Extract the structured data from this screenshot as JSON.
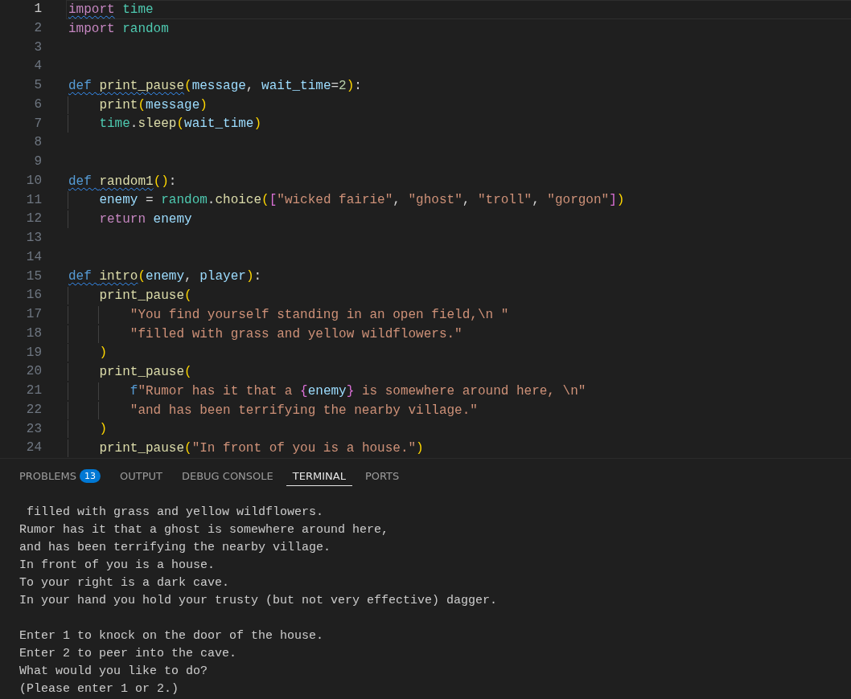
{
  "editor": {
    "lines": [
      {
        "number": "1",
        "selected": true,
        "tokens": [
          {
            "kind": "keyword",
            "text": "import",
            "warning": true
          },
          {
            "kind": "module",
            "text": " time",
            "warning": false
          }
        ]
      },
      {
        "number": "2",
        "selected": false,
        "tokens": [
          {
            "kind": "keyword",
            "text": "import",
            "warning": false
          },
          {
            "kind": "module",
            "text": " random",
            "warning": false
          }
        ]
      },
      {
        "number": "3",
        "selected": false
      },
      {
        "number": "4",
        "selected": false
      },
      {
        "number": "5",
        "selected": false,
        "tokens": [
          {
            "kind": "storage",
            "text": "def ",
            "warning": true
          },
          {
            "kind": "function",
            "text": "print_pause",
            "warning": true
          },
          {
            "kind": "bracket1",
            "text": "(",
            "warning": false
          },
          {
            "kind": "param",
            "text": "message",
            "warning": false
          },
          {
            "kind": "plain",
            "text": ",",
            "warning": false
          },
          {
            "kind": "param",
            "text": " wait_time",
            "warning": false
          },
          {
            "kind": "plain",
            "text": "=",
            "warning": false
          },
          {
            "kind": "number",
            "text": "2",
            "warning": false
          },
          {
            "kind": "bracket1",
            "text": ")",
            "warning": false
          },
          {
            "kind": "plain",
            "text": ":",
            "warning": false
          }
        ]
      },
      {
        "number": "6",
        "selected": false,
        "tokens": [
          {
            "kind": "function",
            "text": "    print",
            "warning": false
          },
          {
            "kind": "bracket1",
            "text": "(",
            "warning": false
          },
          {
            "kind": "param",
            "text": "message",
            "warning": false
          },
          {
            "kind": "bracket1",
            "text": ")",
            "warning": false
          }
        ]
      },
      {
        "number": "7",
        "selected": false,
        "tokens": [
          {
            "kind": "module",
            "text": "    time",
            "warning": false
          },
          {
            "kind": "plain",
            "text": ".",
            "warning": false
          },
          {
            "kind": "function",
            "text": "sleep",
            "warning": false
          },
          {
            "kind": "bracket1",
            "text": "(",
            "warning": false
          },
          {
            "kind": "param",
            "text": "wait_time",
            "warning": false
          },
          {
            "kind": "bracket1",
            "text": ")",
            "warning": false
          }
        ]
      },
      {
        "number": "8",
        "selected": false
      },
      {
        "number": "9",
        "selected": false
      },
      {
        "number": "10",
        "selected": false,
        "tokens": [
          {
            "kind": "storage",
            "text": "def ",
            "warning": true
          },
          {
            "kind": "function",
            "text": "random1",
            "warning": true
          },
          {
            "kind": "bracket1",
            "text": "()",
            "warning": false
          },
          {
            "kind": "plain",
            "text": ":",
            "warning": false
          }
        ]
      },
      {
        "number": "11",
        "selected": false,
        "tokens": [
          {
            "kind": "param",
            "text": "    enemy",
            "warning": false
          },
          {
            "kind": "plain",
            "text": " = ",
            "warning": false
          },
          {
            "kind": "module",
            "text": "random",
            "warning": false
          },
          {
            "kind": "plain",
            "text": ".",
            "warning": false
          },
          {
            "kind": "function",
            "text": "choice",
            "warning": false
          },
          {
            "kind": "bracket1",
            "text": "(",
            "warning": false
          },
          {
            "kind": "bracket2",
            "text": "[",
            "warning": false
          },
          {
            "kind": "string",
            "text": "\"wicked fairie\"",
            "warning": false
          },
          {
            "kind": "plain",
            "text": ", ",
            "warning": false
          },
          {
            "kind": "string",
            "text": "\"ghost\"",
            "warning": false
          },
          {
            "kind": "plain",
            "text": ", ",
            "warning": false
          },
          {
            "kind": "string",
            "text": "\"troll\"",
            "warning": false
          },
          {
            "kind": "plain",
            "text": ", ",
            "warning": false
          },
          {
            "kind": "string",
            "text": "\"gorgon\"",
            "warning": false
          },
          {
            "kind": "bracket2",
            "text": "]",
            "warning": false
          },
          {
            "kind": "bracket1",
            "text": ")",
            "warning": false
          }
        ]
      },
      {
        "number": "12",
        "selected": false,
        "tokens": [
          {
            "kind": "keyword",
            "text": "    return",
            "warning": false
          },
          {
            "kind": "param",
            "text": " enemy",
            "warning": false
          }
        ]
      },
      {
        "number": "13",
        "selected": false
      },
      {
        "number": "14",
        "selected": false
      },
      {
        "number": "15",
        "selected": false,
        "tokens": [
          {
            "kind": "storage",
            "text": "def ",
            "warning": true
          },
          {
            "kind": "function",
            "text": "intro",
            "warning": true
          },
          {
            "kind": "bracket1",
            "text": "(",
            "warning": false
          },
          {
            "kind": "param",
            "text": "enemy",
            "warning": false
          },
          {
            "kind": "plain",
            "text": ",",
            "warning": false
          },
          {
            "kind": "param",
            "text": " player",
            "warning": false
          },
          {
            "kind": "bracket1",
            "text": ")",
            "warning": false
          },
          {
            "kind": "plain",
            "text": ":",
            "warning": false
          }
        ]
      },
      {
        "number": "16",
        "selected": false,
        "tokens": [
          {
            "kind": "function",
            "text": "    print_pause",
            "warning": false
          },
          {
            "kind": "bracket1",
            "text": "(",
            "warning": false
          }
        ]
      },
      {
        "number": "17",
        "selected": false,
        "tokens": [
          {
            "kind": "string",
            "text": "        \"You find yourself standing in an open field,\\n \"",
            "warning": false
          }
        ]
      },
      {
        "number": "18",
        "selected": false,
        "tokens": [
          {
            "kind": "string",
            "text": "        \"filled with grass and yellow wildflowers.\"",
            "warning": false
          }
        ]
      },
      {
        "number": "19",
        "selected": false,
        "tokens": [
          {
            "kind": "bracket1",
            "text": "    )",
            "warning": false
          }
        ]
      },
      {
        "number": "20",
        "selected": false,
        "tokens": [
          {
            "kind": "function",
            "text": "    print_pause",
            "warning": false
          },
          {
            "kind": "bracket1",
            "text": "(",
            "warning": false
          }
        ]
      },
      {
        "number": "21",
        "selected": false,
        "tokens": [
          {
            "kind": "storage",
            "text": "        f",
            "warning": false
          },
          {
            "kind": "string",
            "text": "\"Rumor has it that a ",
            "warning": false
          },
          {
            "kind": "bracket2",
            "text": "{",
            "warning": false
          },
          {
            "kind": "param",
            "text": "enemy",
            "warning": false
          },
          {
            "kind": "bracket2",
            "text": "}",
            "warning": false
          },
          {
            "kind": "string",
            "text": " is somewhere around here, \\n\"",
            "warning": false
          }
        ]
      },
      {
        "number": "22",
        "selected": false,
        "tokens": [
          {
            "kind": "string",
            "text": "        \"and has been terrifying the nearby village.\"",
            "warning": false
          }
        ]
      },
      {
        "number": "23",
        "selected": false,
        "tokens": [
          {
            "kind": "bracket1",
            "text": "    )",
            "warning": false
          }
        ]
      },
      {
        "number": "24",
        "selected": false,
        "tokens": [
          {
            "kind": "function",
            "text": "    print_pause",
            "warning": false
          },
          {
            "kind": "bracket1",
            "text": "(",
            "warning": false
          },
          {
            "kind": "string",
            "text": "\"In front of you is a house.\"",
            "warning": false
          },
          {
            "kind": "bracket1",
            "text": ")",
            "warning": false
          }
        ]
      }
    ]
  },
  "panel": {
    "tabs": [
      {
        "label": "PROBLEMS",
        "badge": "13",
        "selected": false
      },
      {
        "label": "OUTPUT",
        "selected": false
      },
      {
        "label": "DEBUG CONSOLE",
        "selected": false
      },
      {
        "label": "TERMINAL",
        "selected": true
      },
      {
        "label": "PORTS",
        "selected": false
      }
    ],
    "terminal": {
      "blocks": [
        [
          " filled with grass and yellow wildflowers.",
          "Rumor has it that a ghost is somewhere around here,",
          "and has been terrifying the nearby village.",
          "In front of you is a house.",
          "To your right is a dark cave.",
          "In your hand you hold your trusty (but not very effective) dagger."
        ],
        [
          "Enter 1 to knock on the door of the house.",
          "Enter 2 to peer into the cave.",
          "What would you like to do?",
          "(Please enter 1 or 2.)"
        ]
      ]
    }
  }
}
